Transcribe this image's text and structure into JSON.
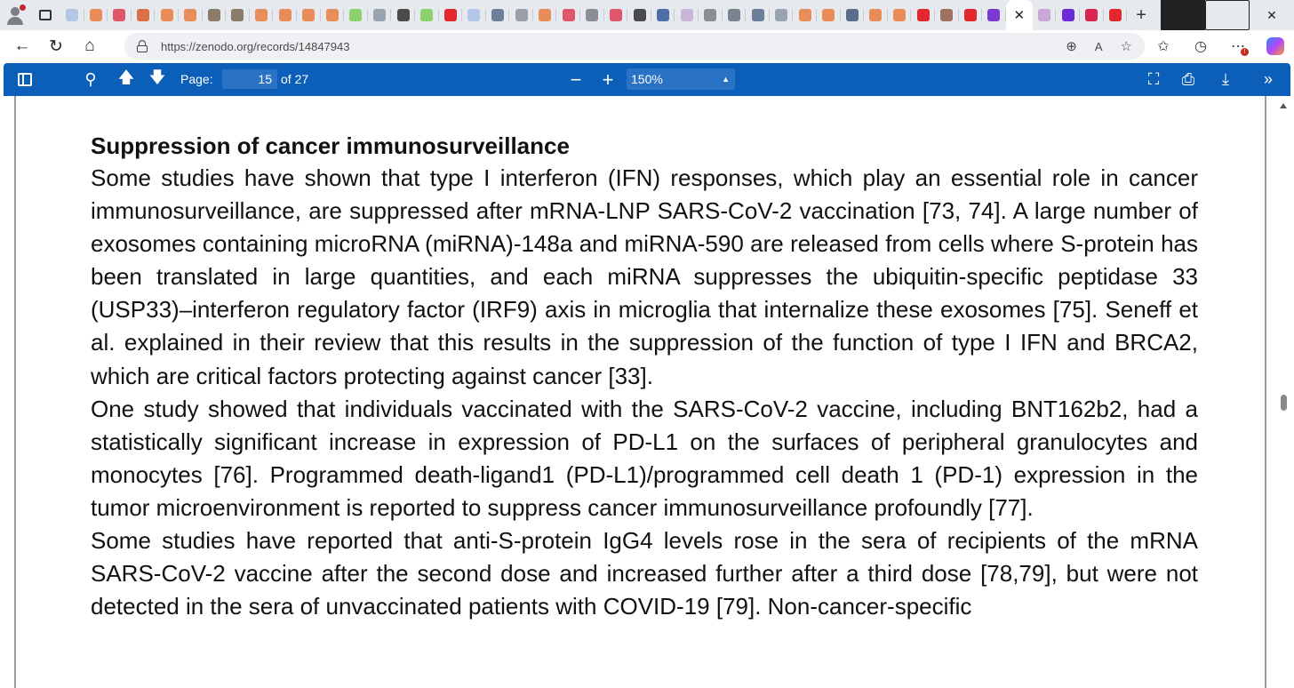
{
  "browser": {
    "url": "https://zenodo.org/records/14847943",
    "active_tab_close": "✕",
    "new_tab": "+",
    "tab_favicon_colors": [
      "#b5c7e6",
      "#e88d5a",
      "#e0566b",
      "#d9704a",
      "#e88d5a",
      "#e88d5a",
      "#8b7b6b",
      "#8b7b6b",
      "#e88d5a",
      "#e88d5a",
      "#e88d5a",
      "#e88d5a",
      "#8fd06b",
      "#9aa4b0",
      "#4b4b4b",
      "#8fd06b",
      "#e3272f",
      "#b5c7e6",
      "#6b7f99",
      "#9aa0aa",
      "#e88d5a",
      "#e0566b",
      "#8a8f96",
      "#e0566b",
      "#4b4b4b",
      "#4f6ea8",
      "#c9b6d8",
      "#8a8f96",
      "#7b8390",
      "#6b7f99",
      "#9aa4b0",
      "#e88d5a",
      "#e88d5a",
      "#5a6d8a",
      "#e88d5a",
      "#e88d5a",
      "#e3272f",
      "#a07060",
      "#e3272f",
      "#7a3ad1"
    ],
    "inactive_after_tabs": [
      "#c7a8d6",
      "#6b2bd6",
      "#d9264f",
      "#e3272f"
    ]
  },
  "pdf_viewer": {
    "page_label": "Page:",
    "page_current": "15",
    "page_total_text": "of 27",
    "zoom": "150%"
  },
  "document": {
    "heading": "Suppression of cancer immunosurveillance",
    "paragraphs": [
      "Some studies have shown that type I interferon (IFN) responses, which play an essential role in cancer immunosurveillance, are suppressed after mRNA-LNP SARS-CoV-2 vaccination [73, 74]. A large number of exosomes containing microRNA (miRNA)-148a and miRNA-590 are released from cells where S-protein has been translated in large quantities, and each miRNA suppresses the ubiquitin-specific peptidase 33 (USP33)–interferon regulatory factor (IRF9) axis in microglia that internalize these exosomes [75]. Seneff et al. explained in their review that this results in the suppression of the function of type I IFN and BRCA2, which are critical factors protecting against cancer [33].",
      "One study showed that individuals vaccinated with the SARS-CoV-2 vaccine, including BNT162b2, had a statistically significant increase in expression of PD-L1 on the surfaces of peripheral granulocytes and monocytes [76]. Programmed death-ligand1 (PD-L1)/programmed cell death 1 (PD-1) expression in the tumor microenvironment is reported to suppress cancer immunosurveillance profoundly [77].",
      "Some studies have reported that anti-S-protein IgG4 levels rose in the sera of recipients of the mRNA SARS-CoV-2 vaccine after the second dose and increased further after a third dose [78,79], but were not detected in the sera of unvaccinated patients with COVID-19 [79]. Non-cancer-specific"
    ]
  },
  "colors": {
    "toolbar": "#0c5fb8",
    "toolbar_field": "#2a72c4",
    "tabstrip": "#e6e9ee"
  }
}
